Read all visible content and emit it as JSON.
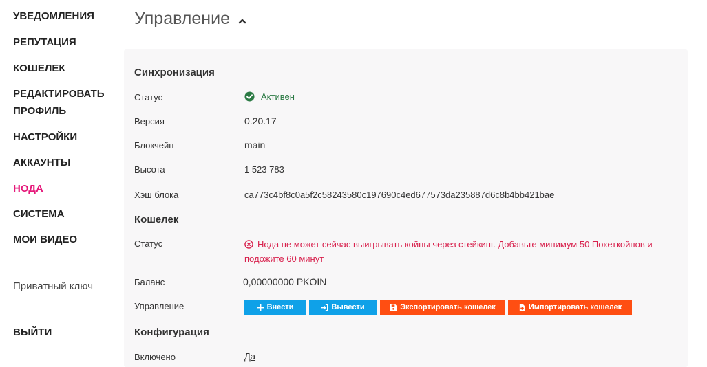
{
  "sidebar": {
    "items": [
      {
        "label": "УВЕДОМЛЕНИЯ"
      },
      {
        "label": "РЕПУТАЦИЯ"
      },
      {
        "label": "КОШЕЛЕК"
      },
      {
        "label": "РЕДАКТИРОВАТЬ"
      },
      {
        "label": "ПРОФИЛЬ"
      },
      {
        "label": "НАСТРОЙКИ"
      },
      {
        "label": "АККАУНТЫ"
      },
      {
        "label": "НОДА"
      },
      {
        "label": "СИСТЕМА"
      },
      {
        "label": "МОИ ВИДЕО"
      }
    ],
    "private_key": "Приватный ключ",
    "logout": "ВЫЙТИ",
    "active_color": "#e5197a"
  },
  "page": {
    "title": "Управление",
    "collapse_icon": "chevron-up-icon"
  },
  "sync": {
    "title": "Синхронизация",
    "status_label": "Статус",
    "status_value": "Активен",
    "version_label": "Версия",
    "version_value": "0.20.17",
    "blockchain_label": "Блокчейн",
    "blockchain_value": "main",
    "height_label": "Высота",
    "height_value": "1 523 783",
    "hash_label": "Хэш блока",
    "hash_value": "ca773c4bf8c0a5f2c58243580c197690c4ed677573da235887d6c8b4bb421bae"
  },
  "wallet": {
    "title": "Кошелек",
    "status_label": "Статус",
    "status_line1": "Нода не может сейчас выигрывать койны через стейкинг. Добавьте минимум 50 Покеткойнов и",
    "status_line2": "подожите 60 минут",
    "balance_label": "Баланс",
    "balance_value": "0,00000000 PKOIN",
    "manage_label": "Управление",
    "buttons": {
      "deposit": "Внести",
      "withdraw": "Вывести",
      "export": "Экспортировать кошелек",
      "import": "Импортировать кошелек"
    },
    "colors": {
      "blue": "#0fa1e8",
      "orange": "#ff4e12",
      "error": "#d8214d",
      "ok": "#2b7a44"
    }
  },
  "config": {
    "title": "Конфигурация",
    "enabled_label": "Включено",
    "enabled_value": "Да"
  }
}
